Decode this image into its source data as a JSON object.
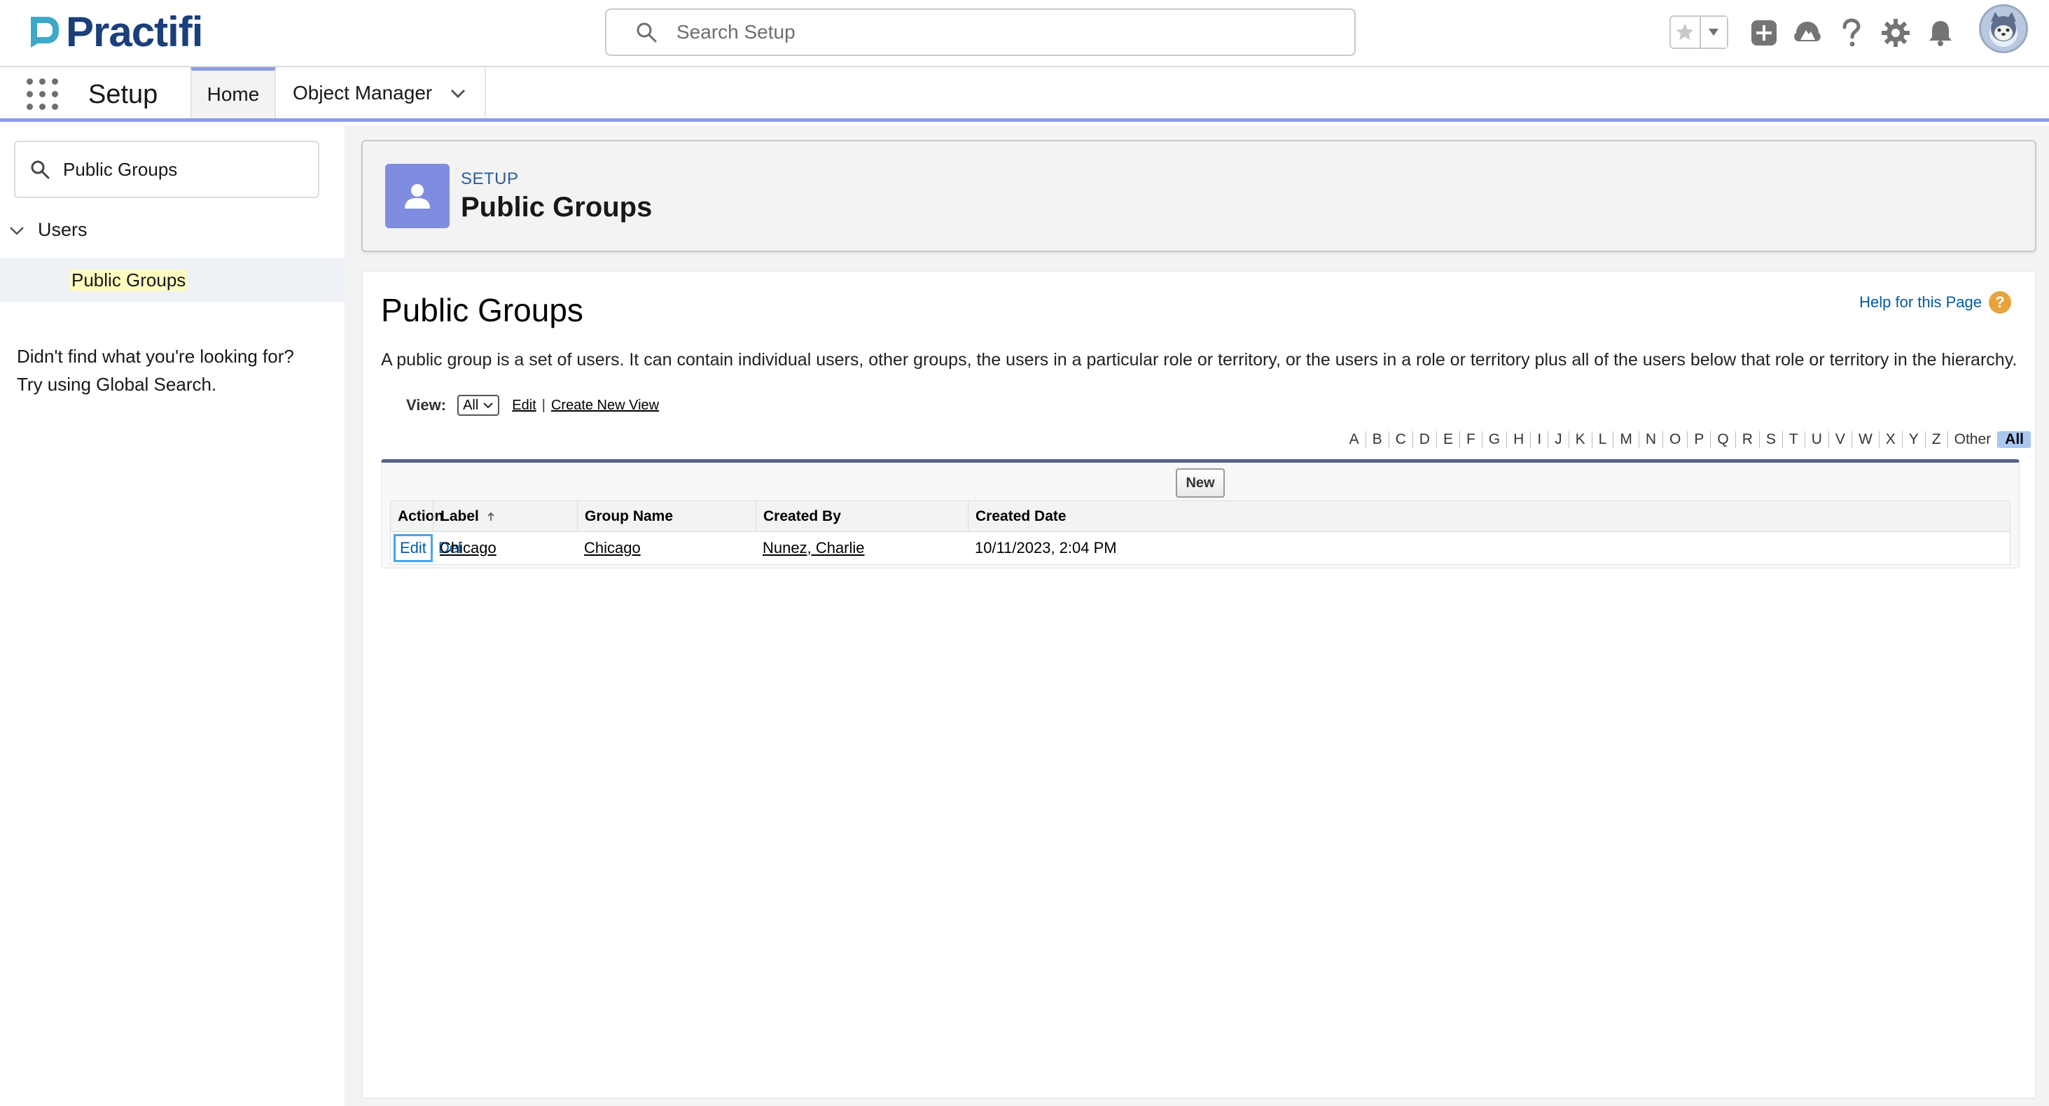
{
  "brand": {
    "name": "Practifi",
    "color": "#1b3f7a",
    "accent": "#3fa9c9"
  },
  "header": {
    "search_placeholder": "Search Setup",
    "icons": [
      "favorites-star-icon",
      "favorites-dropdown-icon",
      "add-icon",
      "trailhead-icon",
      "help-icon",
      "setup-gear-icon",
      "notifications-bell-icon",
      "user-avatar"
    ]
  },
  "nav": {
    "app_name": "Setup",
    "tabs": [
      {
        "label": "Home",
        "active": true
      },
      {
        "label": "Object Manager",
        "active": false
      }
    ]
  },
  "sidebar": {
    "quick_find_value": "Public Groups",
    "tree": {
      "section": "Users",
      "item": "Public Groups"
    },
    "not_found_line1": "Didn't find what you're looking for?",
    "not_found_line2": "Try using Global Search."
  },
  "page_header": {
    "eyebrow": "SETUP",
    "title": "Public Groups",
    "icon_color": "#7f8de1"
  },
  "content": {
    "title": "Public Groups",
    "help_link": "Help for this Page",
    "description": "A public group is a set of users. It can contain individual users, other groups, the users in a particular role or territory, or the users in a role or territory plus all of the users below that role or territory in the hierarchy.",
    "view": {
      "label": "View:",
      "selected": "All",
      "edit_link": "Edit",
      "separator": "|",
      "create_link": "Create New View"
    },
    "alpha": [
      "A",
      "B",
      "C",
      "D",
      "E",
      "F",
      "G",
      "H",
      "I",
      "J",
      "K",
      "L",
      "M",
      "N",
      "O",
      "P",
      "Q",
      "R",
      "S",
      "T",
      "U",
      "V",
      "W",
      "X",
      "Y",
      "Z",
      "Other",
      "All"
    ],
    "alpha_selected": "All",
    "new_button": "New",
    "table": {
      "columns": [
        "Action",
        "Label",
        "Group Name",
        "Created By",
        "Created Date"
      ],
      "rows": [
        {
          "edit": "Edit",
          "del": "Del",
          "label": "Chicago",
          "group_name": "Chicago",
          "created_by": "Nunez, Charlie",
          "created_date": "10/11/2023, 2:04 PM"
        }
      ]
    }
  }
}
